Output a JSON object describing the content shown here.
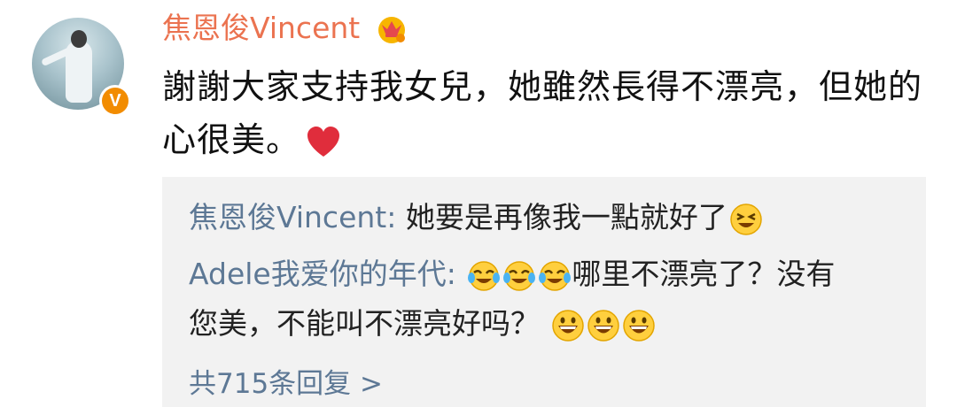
{
  "post": {
    "username": "焦恩俊Vincent",
    "text_line1": "謝謝大家支持我女兒，她雖然長得不漂亮，但她的",
    "text_line2": "心很美。",
    "heart_emoji": "heart-emoji"
  },
  "replies": [
    {
      "name": "焦恩俊Vincent:",
      "text": " 她要是再像我一點就好了",
      "emojis": [
        "laughing-squint"
      ]
    },
    {
      "name": "Adele我爱你的年代:",
      "text_part1": "哪里不漂亮了？没有",
      "text_part2": "您美，不能叫不漂亮好吗？",
      "emojis_before": [
        "crying-laugh",
        "crying-laugh",
        "crying-laugh"
      ],
      "emojis_after": [
        "grin",
        "grin",
        "grin"
      ]
    }
  ],
  "more_replies": "共715条回复 >",
  "colors": {
    "username": "#eb7350",
    "reply_name": "#5d7895",
    "reply_bg": "#f2f2f2",
    "badge": "#f28c00"
  }
}
